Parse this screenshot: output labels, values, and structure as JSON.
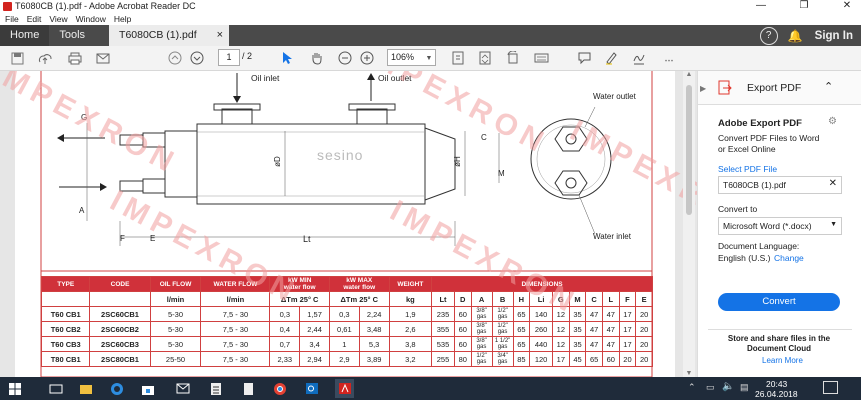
{
  "window": {
    "title": "T6080CB (1).pdf - Adobe Acrobat Reader DC",
    "minimize": "—",
    "maximize": "❐",
    "close": "✕"
  },
  "menu": [
    "File",
    "Edit",
    "View",
    "Window",
    "Help"
  ],
  "tabs": {
    "home": "Home",
    "tools": "Tools",
    "doc": "T6080CB (1).pdf",
    "doc_close": "×",
    "signin": "Sign In"
  },
  "toolbar": {
    "page_current": "1",
    "page_total": "/ 2",
    "zoom": "106%"
  },
  "drawing": {
    "oil_inlet": "Oil inlet",
    "oil_outlet": "Oil outlet",
    "water_outlet": "Water outlet",
    "water_inlet": "Water inlet",
    "brand": "sesino",
    "dims": {
      "g": "G",
      "a": "A",
      "f": "F",
      "e": "E",
      "lt": "Lt",
      "d": "øD",
      "h": "øH",
      "c": "C",
      "m": "M"
    }
  },
  "table": {
    "hdr1": [
      "TYPE",
      "CODE",
      "OIL FLOW",
      "WATER FLOW",
      "kW MIN\nwater flow",
      "kW MAX\nwater flow",
      "WEIGHT",
      "DIMENSIONS"
    ],
    "hdr2": [
      "",
      "",
      "l/min",
      "l/min",
      "ΔTm 25° C",
      "ΔTm 25° C",
      "kg",
      "Lt",
      "D",
      "A",
      "B",
      "H",
      "Li",
      "G",
      "M",
      "C",
      "L",
      "F",
      "E"
    ],
    "rows": [
      [
        "T60 CB1",
        "2SC60CB1",
        "5-30",
        "7,5 - 30",
        "0,3",
        "1,57",
        "0,3",
        "2,24",
        "1,9",
        "235",
        "60",
        "3/8\" gas",
        "1/2\" gas",
        "65",
        "140",
        "12",
        "35",
        "47",
        "47",
        "17",
        "20"
      ],
      [
        "T60 CB2",
        "2SC60CB2",
        "5-30",
        "7,5 - 30",
        "0,4",
        "2,44",
        "0,61",
        "3,48",
        "2,6",
        "355",
        "60",
        "3/8\" gas",
        "1/2\" gas",
        "65",
        "260",
        "12",
        "35",
        "47",
        "47",
        "17",
        "20"
      ],
      [
        "T60 CB3",
        "2SC60CB3",
        "5-30",
        "7,5 - 30",
        "0,7",
        "3,4",
        "1",
        "5,3",
        "3,8",
        "535",
        "60",
        "3/8\" gas",
        "1 1/2\" gas",
        "65",
        "440",
        "12",
        "35",
        "47",
        "47",
        "17",
        "20"
      ],
      [
        "T80 CB1",
        "2SC80CB1",
        "25-50",
        "7,5 - 30",
        "2,33",
        "2,94",
        "2,9",
        "3,89",
        "3,2",
        "255",
        "80",
        "1/2\" gas",
        "3/4\" gas",
        "85",
        "120",
        "17",
        "45",
        "65",
        "60",
        "20",
        "20"
      ]
    ]
  },
  "panel": {
    "title": "Export PDF",
    "heading": "Adobe Export PDF",
    "desc": "Convert PDF Files to Word or Excel Online",
    "select_label": "Select PDF File",
    "file": "T6080CB (1).pdf",
    "convert_to": "Convert to",
    "format": "Microsoft Word (*.docx)",
    "lang_label": "Document Language:",
    "lang": "English (U.S.)",
    "change": "Change",
    "button": "Convert",
    "store": "Store and share files in the Document Cloud",
    "learn": "Learn More"
  },
  "watermark": "IMPEXRON",
  "taskbar": {
    "time": "20:43",
    "date": "26.04.2018"
  },
  "colors": {
    "accent": "#1473e6",
    "tabbar": "#4a4a4a",
    "table_red": "#d0313a",
    "taskbar": "#1f2b3a"
  }
}
